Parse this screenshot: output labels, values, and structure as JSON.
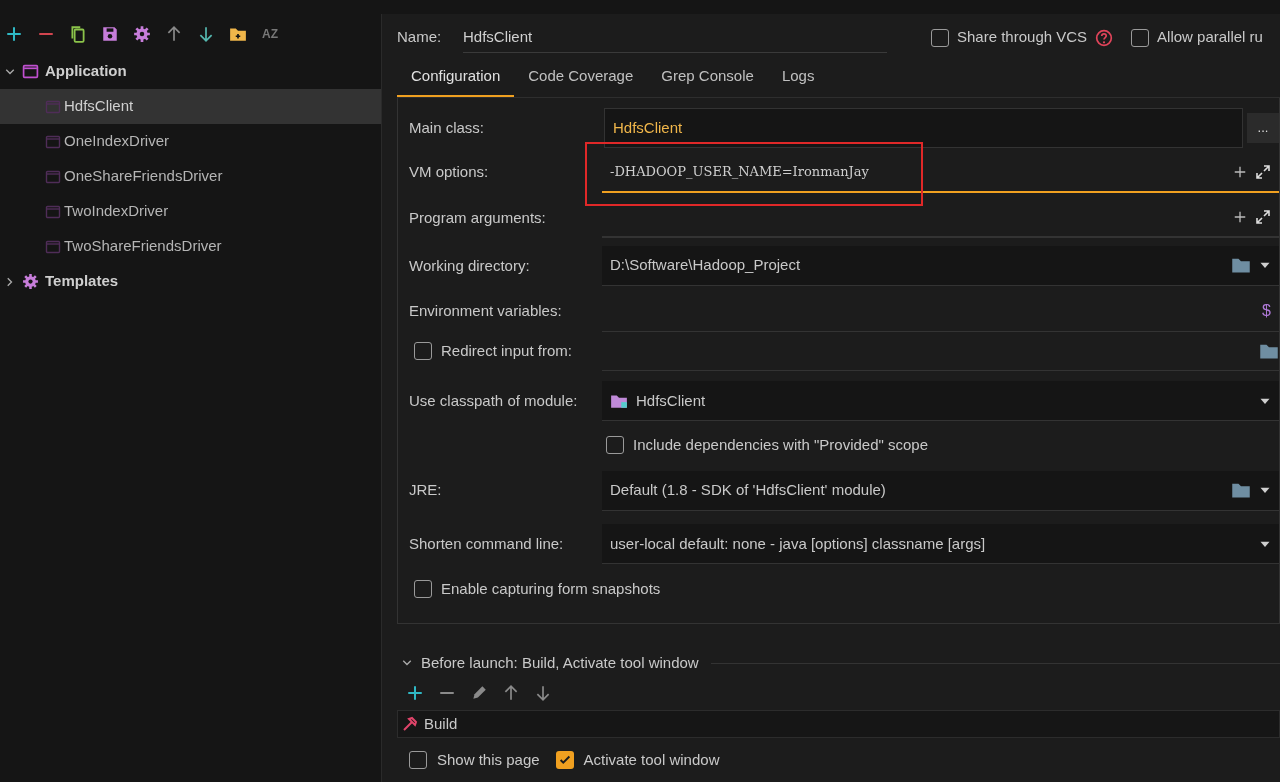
{
  "toolbar": {
    "tools": [
      {
        "kind": "add"
      },
      {
        "kind": "remove"
      },
      {
        "kind": "copy"
      },
      {
        "kind": "save"
      },
      {
        "kind": "settings"
      },
      {
        "kind": "up"
      },
      {
        "kind": "down"
      },
      {
        "kind": "folder"
      },
      {
        "kind": "sort",
        "label": "AZ"
      }
    ]
  },
  "tree": [
    {
      "label": "Application",
      "kind": "app",
      "expanded": true,
      "children": [
        {
          "label": "HdfsClient",
          "selected": true
        },
        {
          "label": "OneIndexDriver",
          "selected": false
        },
        {
          "label": "OneShareFriendsDriver",
          "selected": false
        },
        {
          "label": "TwoIndexDriver",
          "selected": false
        },
        {
          "label": "TwoShareFriendsDriver",
          "selected": false
        }
      ]
    },
    {
      "label": "Templates",
      "kind": "templates",
      "expanded": false
    }
  ],
  "name_field": {
    "label": "Name:",
    "value": "HdfsClient"
  },
  "options": [
    {
      "label": "Share through VCS",
      "checked": false,
      "help": true
    },
    {
      "label": "Allow parallel ru",
      "checked": false,
      "help": false
    }
  ],
  "tabs": [
    {
      "label": "Configuration",
      "selected": true
    },
    {
      "label": "Code Coverage",
      "selected": false
    },
    {
      "label": "Grep Console",
      "selected": false
    },
    {
      "label": "Logs",
      "selected": false
    }
  ],
  "form": [
    {
      "kind": "browse",
      "label": "Main class:",
      "value": "HdfsClient",
      "button": "..."
    },
    {
      "kind": "expandable",
      "label": "VM options:",
      "value": "-DHADOOP_USER_NAME=IronmanJay",
      "focused": true,
      "highlighted": true
    },
    {
      "kind": "expandable",
      "label": "Program arguments:",
      "focused": false,
      "highlighted": false
    },
    {
      "kind": "path_combo",
      "label": "Working directory:",
      "value": "D:\\Software\\Hadoop_Project"
    },
    {
      "kind": "env",
      "label": "Environment variables:",
      "icon": "$"
    },
    {
      "kind": "file",
      "label": "Redirect input from:",
      "checked": false
    },
    {
      "kind": "module_combo",
      "label": "Use classpath of module:",
      "value": "HdfsClient"
    },
    {
      "kind": "checkbox",
      "label": "Include dependencies with \"Provided\" scope",
      "checked": false
    },
    {
      "kind": "path_combo",
      "label": "JRE:",
      "value": "Default (1.8 - SDK of 'HdfsClient' module)"
    },
    {
      "kind": "combo",
      "label": "Shorten command line:",
      "value": "user-local default: none - java [options] classname [args]"
    },
    {
      "kind": "checkbox_left",
      "label": "Enable capturing form snapshots",
      "checked": false
    }
  ],
  "before_launch": {
    "title": "Before launch: Build, Activate tool window",
    "expanded": true,
    "tools": [
      {
        "kind": "add"
      },
      {
        "kind": "remove"
      },
      {
        "kind": "edit"
      },
      {
        "kind": "up"
      },
      {
        "kind": "down"
      }
    ],
    "tasks": [
      {
        "label": "Build"
      }
    ]
  },
  "footer": [
    {
      "label": "Show this page",
      "checked": false
    },
    {
      "label": "Activate tool window",
      "checked": true
    }
  ]
}
